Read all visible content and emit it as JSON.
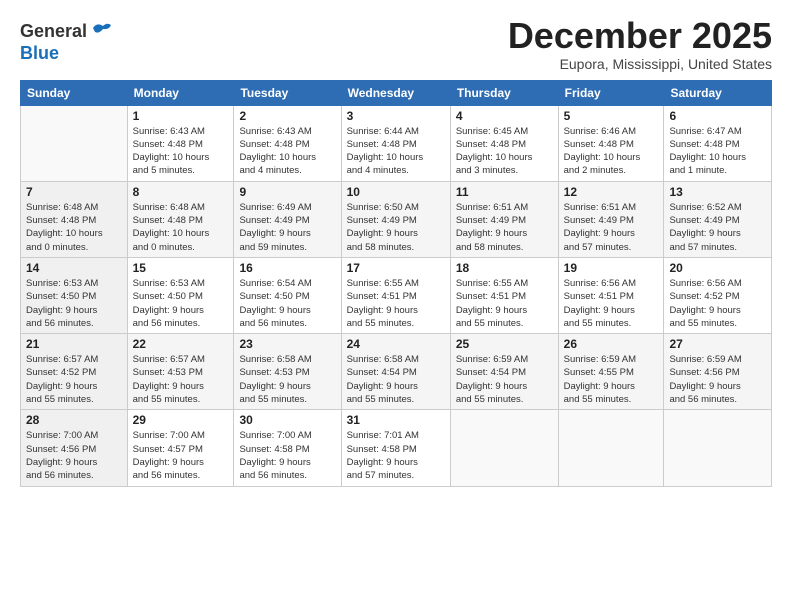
{
  "header": {
    "logo_line1": "General",
    "logo_line2": "Blue",
    "month": "December 2025",
    "location": "Eupora, Mississippi, United States"
  },
  "weekdays": [
    "Sunday",
    "Monday",
    "Tuesday",
    "Wednesday",
    "Thursday",
    "Friday",
    "Saturday"
  ],
  "weeks": [
    [
      {
        "day": "",
        "info": ""
      },
      {
        "day": "1",
        "info": "Sunrise: 6:43 AM\nSunset: 4:48 PM\nDaylight: 10 hours\nand 5 minutes."
      },
      {
        "day": "2",
        "info": "Sunrise: 6:43 AM\nSunset: 4:48 PM\nDaylight: 10 hours\nand 4 minutes."
      },
      {
        "day": "3",
        "info": "Sunrise: 6:44 AM\nSunset: 4:48 PM\nDaylight: 10 hours\nand 4 minutes."
      },
      {
        "day": "4",
        "info": "Sunrise: 6:45 AM\nSunset: 4:48 PM\nDaylight: 10 hours\nand 3 minutes."
      },
      {
        "day": "5",
        "info": "Sunrise: 6:46 AM\nSunset: 4:48 PM\nDaylight: 10 hours\nand 2 minutes."
      },
      {
        "day": "6",
        "info": "Sunrise: 6:47 AM\nSunset: 4:48 PM\nDaylight: 10 hours\nand 1 minute."
      }
    ],
    [
      {
        "day": "7",
        "info": "Sunrise: 6:48 AM\nSunset: 4:48 PM\nDaylight: 10 hours\nand 0 minutes."
      },
      {
        "day": "8",
        "info": "Sunrise: 6:48 AM\nSunset: 4:48 PM\nDaylight: 10 hours\nand 0 minutes."
      },
      {
        "day": "9",
        "info": "Sunrise: 6:49 AM\nSunset: 4:49 PM\nDaylight: 9 hours\nand 59 minutes."
      },
      {
        "day": "10",
        "info": "Sunrise: 6:50 AM\nSunset: 4:49 PM\nDaylight: 9 hours\nand 58 minutes."
      },
      {
        "day": "11",
        "info": "Sunrise: 6:51 AM\nSunset: 4:49 PM\nDaylight: 9 hours\nand 58 minutes."
      },
      {
        "day": "12",
        "info": "Sunrise: 6:51 AM\nSunset: 4:49 PM\nDaylight: 9 hours\nand 57 minutes."
      },
      {
        "day": "13",
        "info": "Sunrise: 6:52 AM\nSunset: 4:49 PM\nDaylight: 9 hours\nand 57 minutes."
      }
    ],
    [
      {
        "day": "14",
        "info": "Sunrise: 6:53 AM\nSunset: 4:50 PM\nDaylight: 9 hours\nand 56 minutes."
      },
      {
        "day": "15",
        "info": "Sunrise: 6:53 AM\nSunset: 4:50 PM\nDaylight: 9 hours\nand 56 minutes."
      },
      {
        "day": "16",
        "info": "Sunrise: 6:54 AM\nSunset: 4:50 PM\nDaylight: 9 hours\nand 56 minutes."
      },
      {
        "day": "17",
        "info": "Sunrise: 6:55 AM\nSunset: 4:51 PM\nDaylight: 9 hours\nand 55 minutes."
      },
      {
        "day": "18",
        "info": "Sunrise: 6:55 AM\nSunset: 4:51 PM\nDaylight: 9 hours\nand 55 minutes."
      },
      {
        "day": "19",
        "info": "Sunrise: 6:56 AM\nSunset: 4:51 PM\nDaylight: 9 hours\nand 55 minutes."
      },
      {
        "day": "20",
        "info": "Sunrise: 6:56 AM\nSunset: 4:52 PM\nDaylight: 9 hours\nand 55 minutes."
      }
    ],
    [
      {
        "day": "21",
        "info": "Sunrise: 6:57 AM\nSunset: 4:52 PM\nDaylight: 9 hours\nand 55 minutes."
      },
      {
        "day": "22",
        "info": "Sunrise: 6:57 AM\nSunset: 4:53 PM\nDaylight: 9 hours\nand 55 minutes."
      },
      {
        "day": "23",
        "info": "Sunrise: 6:58 AM\nSunset: 4:53 PM\nDaylight: 9 hours\nand 55 minutes."
      },
      {
        "day": "24",
        "info": "Sunrise: 6:58 AM\nSunset: 4:54 PM\nDaylight: 9 hours\nand 55 minutes."
      },
      {
        "day": "25",
        "info": "Sunrise: 6:59 AM\nSunset: 4:54 PM\nDaylight: 9 hours\nand 55 minutes."
      },
      {
        "day": "26",
        "info": "Sunrise: 6:59 AM\nSunset: 4:55 PM\nDaylight: 9 hours\nand 55 minutes."
      },
      {
        "day": "27",
        "info": "Sunrise: 6:59 AM\nSunset: 4:56 PM\nDaylight: 9 hours\nand 56 minutes."
      }
    ],
    [
      {
        "day": "28",
        "info": "Sunrise: 7:00 AM\nSunset: 4:56 PM\nDaylight: 9 hours\nand 56 minutes."
      },
      {
        "day": "29",
        "info": "Sunrise: 7:00 AM\nSunset: 4:57 PM\nDaylight: 9 hours\nand 56 minutes."
      },
      {
        "day": "30",
        "info": "Sunrise: 7:00 AM\nSunset: 4:58 PM\nDaylight: 9 hours\nand 56 minutes."
      },
      {
        "day": "31",
        "info": "Sunrise: 7:01 AM\nSunset: 4:58 PM\nDaylight: 9 hours\nand 57 minutes."
      },
      {
        "day": "",
        "info": ""
      },
      {
        "day": "",
        "info": ""
      },
      {
        "day": "",
        "info": ""
      }
    ]
  ]
}
